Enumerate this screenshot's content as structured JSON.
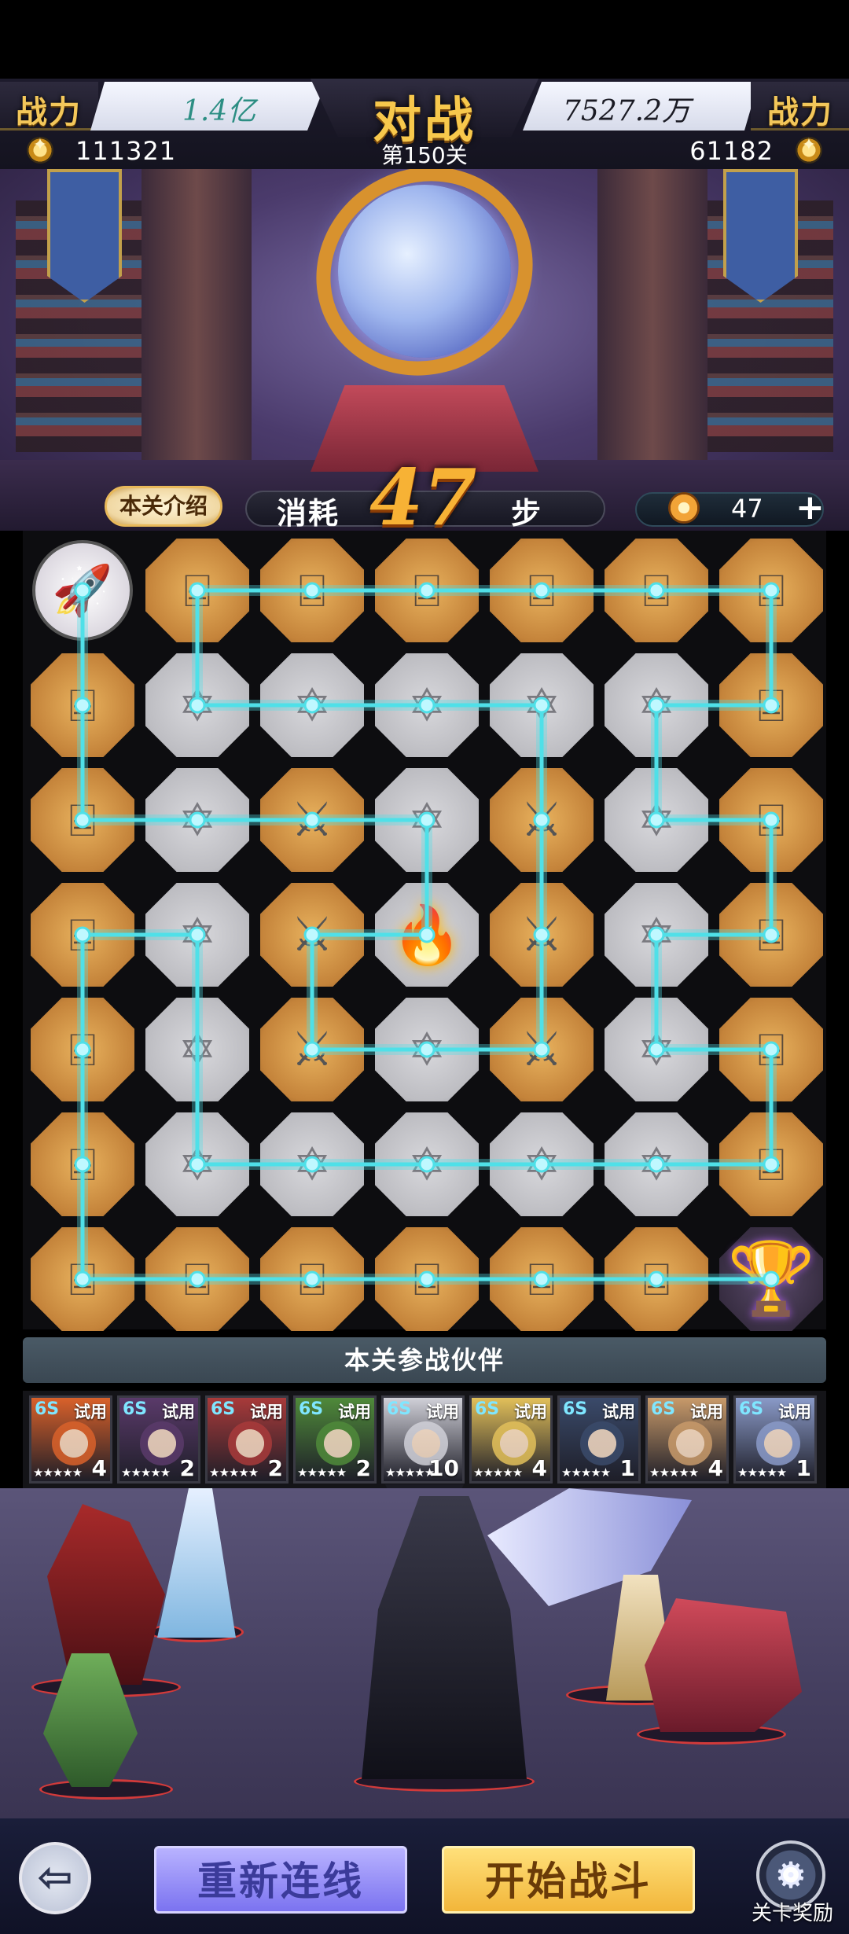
{
  "header": {
    "left_power_label": "战力",
    "left_power_value": "1.4亿",
    "title": "对战",
    "right_power_value": "7527.2万",
    "right_power_label": "战力",
    "left_score": "111321",
    "level": "第150关",
    "right_score": "61182"
  },
  "stage": {
    "intro_button": "本关介绍",
    "cost_label": "消耗",
    "steps": "47",
    "steps_unit": "步",
    "energy": "47",
    "add_icon": "plus-icon"
  },
  "board": {
    "columns": 7,
    "rows": 7,
    "tiles": [
      [
        "start",
        "gold",
        "gold",
        "gold",
        "gold",
        "gold",
        "gold"
      ],
      [
        "gold",
        "grey",
        "grey",
        "grey",
        "grey",
        "grey",
        "gold"
      ],
      [
        "gold",
        "grey",
        "blade",
        "grey",
        "blade",
        "grey",
        "gold"
      ],
      [
        "gold",
        "grey",
        "blade",
        "fire",
        "blade",
        "grey",
        "gold"
      ],
      [
        "gold",
        "grey",
        "blade",
        "grey",
        "blade",
        "grey",
        "gold"
      ],
      [
        "gold",
        "grey",
        "grey",
        "grey",
        "grey",
        "grey",
        "gold"
      ],
      [
        "gold",
        "gold",
        "gold",
        "gold",
        "gold",
        "gold",
        "trophy"
      ]
    ],
    "path": [
      [
        0,
        0
      ],
      [
        0,
        1
      ],
      [
        0,
        2
      ],
      [
        1,
        2
      ],
      [
        2,
        2
      ],
      [
        3,
        2
      ],
      [
        3,
        3
      ],
      [
        2,
        3
      ],
      [
        2,
        4
      ],
      [
        3,
        4
      ],
      [
        4,
        4
      ],
      [
        4,
        3
      ],
      [
        4,
        2
      ],
      [
        4,
        1
      ],
      [
        3,
        1
      ],
      [
        2,
        1
      ],
      [
        1,
        1
      ],
      [
        1,
        0
      ],
      [
        2,
        0
      ],
      [
        3,
        0
      ],
      [
        4,
        0
      ],
      [
        5,
        0
      ],
      [
        6,
        0
      ],
      [
        6,
        1
      ],
      [
        5,
        1
      ],
      [
        5,
        2
      ],
      [
        6,
        2
      ],
      [
        6,
        3
      ],
      [
        5,
        3
      ],
      [
        5,
        4
      ],
      [
        6,
        4
      ],
      [
        6,
        5
      ],
      [
        5,
        5
      ],
      [
        4,
        5
      ],
      [
        3,
        5
      ],
      [
        2,
        5
      ],
      [
        1,
        5
      ],
      [
        1,
        3
      ],
      [
        0,
        3
      ],
      [
        0,
        4
      ],
      [
        0,
        5
      ],
      [
        0,
        6
      ],
      [
        1,
        6
      ],
      [
        2,
        6
      ],
      [
        3,
        6
      ],
      [
        4,
        6
      ],
      [
        5,
        6
      ],
      [
        6,
        6
      ]
    ],
    "line_color": "#4fe0e8"
  },
  "partners": {
    "title": "本关参战伙伴",
    "items": [
      {
        "grade": "6S",
        "tag": "试用",
        "stars": "★★★★★",
        "count": "4",
        "color": "#d9612a"
      },
      {
        "grade": "6S",
        "tag": "试用",
        "stars": "★★★★★",
        "count": "2",
        "color": "#5a3a6a"
      },
      {
        "grade": "6S",
        "tag": "试用",
        "stars": "★★★★★",
        "count": "2",
        "color": "#a83a3a"
      },
      {
        "grade": "6S",
        "tag": "试用",
        "stars": "★★★★★",
        "count": "2",
        "color": "#4f8a3a"
      },
      {
        "grade": "6S",
        "tag": "试用",
        "stars": "★★★★★",
        "count": "10",
        "color": "#d0d0d8"
      },
      {
        "grade": "6S",
        "tag": "试用",
        "stars": "★★★★★",
        "count": "4",
        "color": "#e2c05a"
      },
      {
        "grade": "6S",
        "tag": "试用",
        "stars": "★★★★★",
        "count": "1",
        "color": "#3a4a6a"
      },
      {
        "grade": "6S",
        "tag": "试用",
        "stars": "★★★★★",
        "count": "4",
        "color": "#c89a6a"
      },
      {
        "grade": "6S",
        "tag": "试用",
        "stars": "★★★★★",
        "count": "1",
        "color": "#8a9ac8"
      }
    ],
    "collapse_icon": "⌄"
  },
  "bottom": {
    "back_icon": "⇦",
    "relink_button": "重新连线",
    "start_button": "开始战斗",
    "reward_label": "关卡奖励"
  },
  "colors": {
    "accent_gold": "#f7c84c",
    "path_line": "#4fe0e8"
  }
}
